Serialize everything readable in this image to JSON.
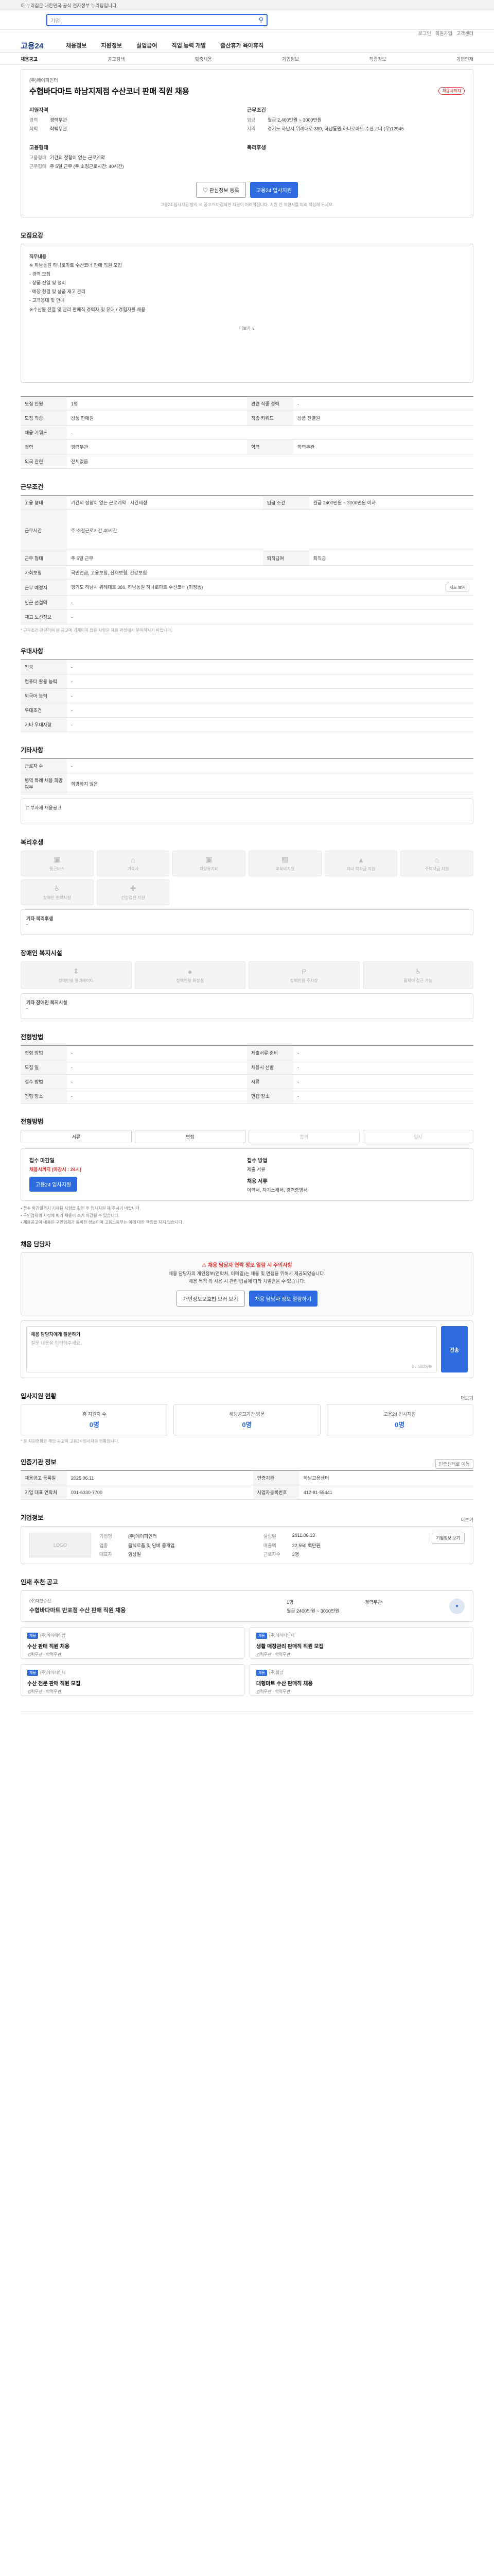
{
  "gov_banner": "이 누리집은 대한민국 공식 전자정부 누리집입니다.",
  "search": {
    "placeholder": "기업"
  },
  "util": [
    "로그인",
    "회원가입",
    "고객센터"
  ],
  "logo": "고용24",
  "gnb": [
    "채용정보",
    "지원정보",
    "실업급여",
    "직업 능력 개발",
    "출산휴가 육아휴직"
  ],
  "subnav": [
    "채용공고",
    "공고검색",
    "맞춤채용",
    "기업정보",
    "직종정보",
    "기업인재"
  ],
  "job": {
    "company": "(주)에이피인터",
    "title": "수협바다마트 하남지제점 수산코너 판매 직원 채용",
    "badge": "채용시까지",
    "req_label": "지원자격",
    "req": [
      {
        "k": "경력",
        "v": "경력무관"
      },
      {
        "k": "학력",
        "v": "학력무관"
      }
    ],
    "cond_label": "근무조건",
    "cond": [
      {
        "k": "임금",
        "v": "월급 2,400만원 ~ 3000만원"
      },
      {
        "k": "지역",
        "v": "경기도 하남시 위례대로 380, 하남동원 하나로마트 수산코너 (우)12945"
      }
    ],
    "worktype_label": "고용형태",
    "worktype": [
      {
        "k": "고용형태",
        "v": "기간의 정함이 없는 근로계약"
      },
      {
        "k": "근무형태",
        "v": "주 5일 근무 (주 소정근로시간: 40시간)"
      }
    ],
    "welfare_label": "복리후생",
    "btn_scrap": "관심정보 등록",
    "btn_apply": "고용24 입사지원",
    "note": "고용24 입사지원 방식 시 공고가 마감되면 지원이 어려워집니다. 지원 전 지원서를 미리 작성해 두세요."
  },
  "desc": {
    "title": "모집요강",
    "lines": [
      "직무내용",
      "※ 하남동원 하나로마트 수산코너 판매 직원 모집",
      "- 경력 모집",
      "- 상품 진열 및 정리",
      "- 매장 청결 및 상품 재고 관리",
      "- 고객응대 및 안내",
      "※수산물 진열 및 관리 판매직 경력자 및 유대 / 경험자를 채용"
    ],
    "more": "더보기 ∨"
  },
  "recruit": {
    "rows": [
      [
        "모집 인원",
        "1명",
        "관련 직종 경력",
        "-"
      ],
      [
        "모집 직종",
        "상품 판매원",
        "직종 키워드",
        "상품 진열원"
      ],
      [
        "채용 키워드",
        "-",
        "",
        ""
      ],
      [
        "경력",
        "경력무관",
        "학력",
        "학력무관"
      ],
      [
        "외국 관련",
        "전체없음",
        "",
        ""
      ]
    ]
  },
  "cond": {
    "title": "근무조건",
    "rows": [
      [
        "고용 형태",
        "기간의 정함이 없는 근로계약 · 시간제정",
        "임금 조건",
        "월급 2400만원 ~ 3000만원 이하"
      ],
      [
        "근무시간",
        "주 소정근로시간 40시간",
        "",
        ""
      ],
      [
        "근무 형태",
        "주 5일 근무",
        "퇴직급여",
        "퇴직금"
      ],
      [
        "사회보험",
        "국민연금, 고용보험, 산재보험, 건강보험",
        "",
        ""
      ],
      [
        "근무 예정지",
        "경기도 하남시 위례대로 380, 하남동원 하나로마트 수산코너 (미정동)",
        "",
        ""
      ],
      [
        "인근 전철역",
        "-",
        "",
        ""
      ],
      [
        "재고 노선정보",
        "-",
        "",
        ""
      ]
    ],
    "map_btn": "지도 보기",
    "note": "* 근무조건 관련하여 본 공고에 기재되지 않은 사항은 채용 과정에서 문의하시기 바랍니다."
  },
  "pref": {
    "title": "우대사항",
    "rows": [
      "전공",
      "컴퓨터 활용 능력",
      "외국어 능력",
      "우대조건",
      "기타 우대사항"
    ]
  },
  "etc": {
    "title": "기타사항",
    "rows": [
      [
        "근로자 수",
        "-"
      ],
      [
        "병역 특례 채용 희망 여부",
        "희망하지 않음"
      ]
    ],
    "link": "□ 부자재 채용공고"
  },
  "welfare": {
    "title": "복리후생",
    "items": [
      "통근버스",
      "기숙사",
      "차량유지비",
      "교육비지원",
      "자녀 학자금 지원",
      "주택자금 지원",
      "장애인 편의시설",
      "건강검진 지원"
    ],
    "etc_label": "기타 복리후생",
    "etc_value": "-"
  },
  "disabled": {
    "title": "장애인 복지시설",
    "items": [
      "장애인용 엘리베이터",
      "장애인용 화장실",
      "장애인용 주차장",
      "휠체어 접근 가능"
    ],
    "etc_label": "기타 장애인 복지시설",
    "etc_value": "-"
  },
  "selection": {
    "title": "전형방법",
    "rows": [
      [
        "전형 방법",
        "-",
        "제출서류 준비",
        "-"
      ],
      [
        "모집 일",
        "-",
        "채용시 선발",
        "-"
      ],
      [
        "접수 방법",
        "-",
        "서류",
        "-"
      ],
      [
        "전형 장소",
        "-",
        "면접 장소",
        "-"
      ]
    ]
  },
  "process": {
    "title": "전형방법",
    "steps": [
      "서류",
      "면접",
      "합격",
      "입사"
    ]
  },
  "apply": {
    "label1": "접수 마감일",
    "value1": "채용시까지 (마감시 : 24시)",
    "btn": "고용24 입사지원",
    "label2": "접수 방법",
    "value2": "제출 서류",
    "label3": "채용 서류",
    "value3": "이력서, 자기소개서, 경력증명서",
    "notes": [
      "• 접수 마감일까지 기재된 사항을 확인 후 입사지원 해 주시기 바랍니다.",
      "• 구인업체의 사정에 따라 채용이 조기 마감될 수 있습니다.",
      "• 채용공고의 내용은 구인업체가 등록한 정보이며 고용노동부는 이에 대한 책임을 지지 않습니다."
    ]
  },
  "contact": {
    "title": "채용 담당자",
    "warn": "채용 담당자 연락 정보 열람 시 주의사항",
    "lines": [
      "채용 담당자의 개인정보(연락처, 이메일)는 채용 및 면접을 위해서 제공되었습니다.",
      "채용 목적 외 사용 시 관련 법률에 따라 처벌받을 수 있습니다."
    ],
    "btn1": "개인정보보호법 보러 보기",
    "btn2": "채용 담당자 정보 열람하기",
    "inq_label": "채용 담당자에게 질문하기",
    "inq_placeholder": "질문 내용을 입력해주세요.",
    "inq_count": "0 / 500byte",
    "inq_send": "전송"
  },
  "stats": {
    "title": "입사지원 현황",
    "more": "더보기",
    "items": [
      [
        "총 지원자 수",
        "0명"
      ],
      [
        "해당공고기간 방문",
        "0명"
      ],
      [
        "고용24 입사지원",
        "0명"
      ]
    ],
    "note": "* 본 지원현황은 해당 공고의 고용24 입사지원 현황입니다."
  },
  "reg": {
    "title": "인증기관 정보",
    "rows": [
      [
        "채용공고 등록일",
        "2025.06.11",
        "인증기관",
        "하남고용센터"
      ],
      [
        "기업 대표 연락처",
        "031-6330-7700",
        "사업자등록번호",
        "412-81-55441"
      ]
    ],
    "btn": "인증센터로 이동"
  },
  "company": {
    "title": "기업정보",
    "logo": "LOGO",
    "rows": [
      [
        "기업명",
        "(주)에이피인터",
        "설립일",
        "2011.06.13"
      ],
      [
        "업종",
        "음식료품 및 담배 중개업",
        "매출액",
        "22,550 백만원"
      ],
      [
        "대표자",
        "엄상일",
        "근로자수",
        "3명"
      ]
    ],
    "btn": "기업정보 보기",
    "more": "더보기"
  },
  "related": {
    "title": "인재 추천 공고",
    "featured": {
      "company": "(주)대한수산",
      "title": "수협바다마트 반포점 수산 판매 직원 채용",
      "meta": [
        "1명",
        "경력무관",
        "월급 2400만원 ~ 3000만원"
      ]
    },
    "cards": [
      {
        "tag": "채용",
        "company": "(주)아이에이팜",
        "title": "수산 판매 직원 채용",
        "meta": "경력무관 · 학력무관"
      },
      {
        "tag": "채용",
        "company": "(주)에이피인터",
        "title": "생활 매장관리 판매직 직원 모집",
        "meta": "경력무관 · 학력무관"
      },
      {
        "tag": "채용",
        "company": "(주)에이피인터",
        "title": "수산 전문 판매 직원 모집",
        "meta": "경력무관 · 학력무관"
      },
      {
        "tag": "채용",
        "company": "(주)웰팜",
        "title": "대형마트 수산 판매직 채용",
        "meta": "경력무관 · 학력무관"
      }
    ]
  }
}
